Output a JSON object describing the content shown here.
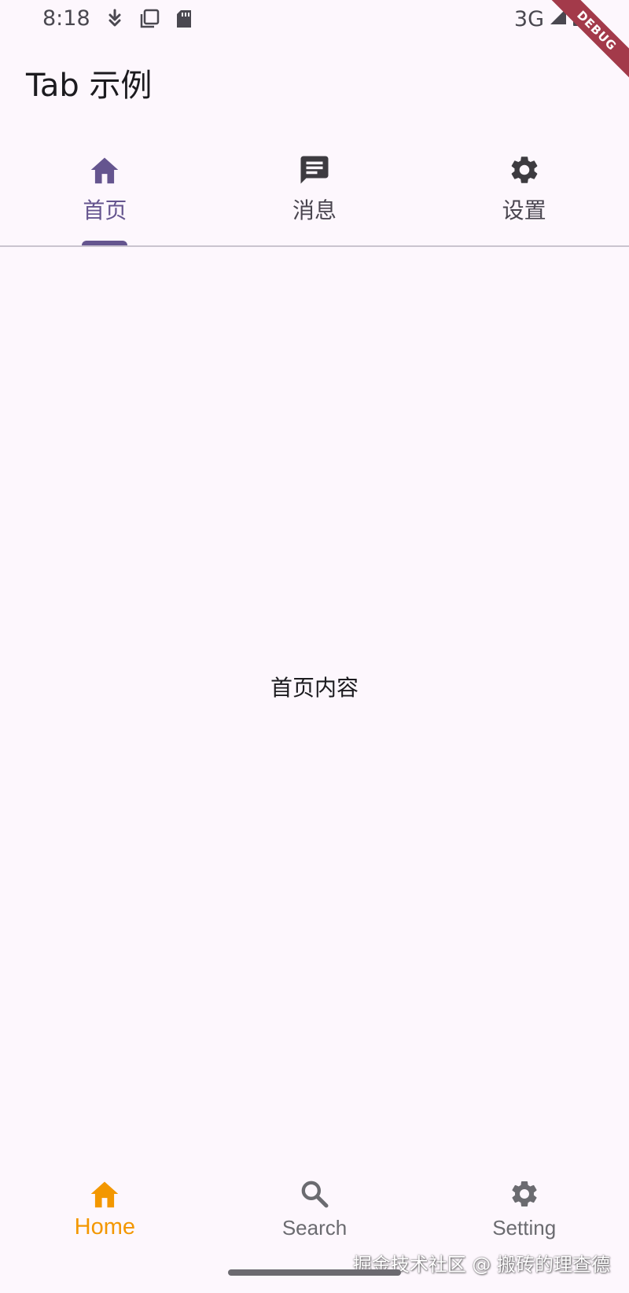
{
  "status_bar": {
    "time": "8:18",
    "network": "3G"
  },
  "debug_banner": "DEBUG",
  "app_bar": {
    "title": "Tab 示例"
  },
  "tabs": [
    {
      "label": "首页",
      "icon": "home-icon",
      "active": true
    },
    {
      "label": "消息",
      "icon": "message-icon",
      "active": false
    },
    {
      "label": "设置",
      "icon": "gear-icon",
      "active": false
    }
  ],
  "content": {
    "text": "首页内容"
  },
  "bottom_nav": [
    {
      "label": "Home",
      "icon": "home-icon",
      "active": true
    },
    {
      "label": "Search",
      "icon": "search-icon",
      "active": false
    },
    {
      "label": "Setting",
      "icon": "gear-icon",
      "active": false
    }
  ],
  "watermark": "掘金技术社区 @ 搬砖的理查德",
  "colors": {
    "background": "#fdf7fd",
    "tab_active": "#65558f",
    "tab_inactive": "#49454f",
    "bottom_active": "#f39700",
    "bottom_inactive": "#6b6b70",
    "debug_banner": "#a33a4a"
  }
}
